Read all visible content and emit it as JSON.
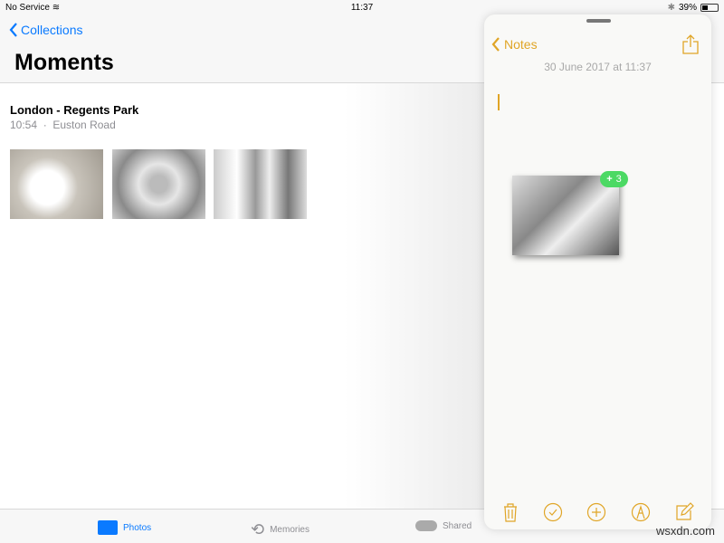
{
  "status": {
    "carrier": "No Service",
    "time": "11:37",
    "battery": "39%",
    "battery_level": 0.39
  },
  "nav": {
    "back_label": "Collections",
    "title": "Moments"
  },
  "moment": {
    "title": "London - Regents Park",
    "time": "10:54",
    "separator": "·",
    "place": "Euston Road"
  },
  "photos": [
    {
      "subject": "mug"
    },
    {
      "subject": "headphones"
    },
    {
      "subject": "office"
    }
  ],
  "tabs": [
    {
      "label": "Photos",
      "active": true,
      "icon": "photos-icon"
    },
    {
      "label": "Memories",
      "icon": "memories-icon"
    },
    {
      "label": "Shared",
      "icon": "cloud-icon"
    }
  ],
  "notes": {
    "back_label": "Notes",
    "date": "30 June 2017 at 11:37",
    "drag_badge": "3",
    "accent": "#e0a526"
  },
  "colors": {
    "tint": "#0a7aff",
    "badge": "#4cd964"
  },
  "watermark": "wsxdn.com"
}
